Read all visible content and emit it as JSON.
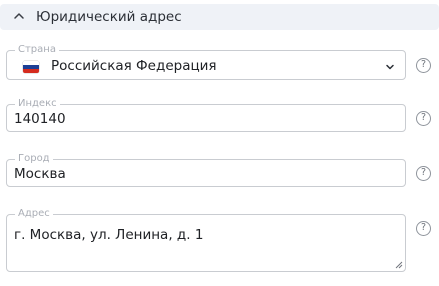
{
  "section": {
    "title": "Юридический адрес",
    "chevron_icon": "chevron-up-icon"
  },
  "fields": {
    "country": {
      "label": "Страна",
      "value": "Российская Федерация",
      "flag_icon": "russia-flag-icon",
      "dropdown_icon": "chevron-down-icon",
      "help": "?"
    },
    "postal_code": {
      "label": "Индекс",
      "value": "140140",
      "help": "?"
    },
    "city": {
      "label": "Город",
      "value": "Москва",
      "help": "?"
    },
    "address": {
      "label": "Адрес",
      "value": "г. Москва, ул. Ленина, д. 1",
      "help": "?"
    }
  },
  "colors": {
    "header_bg": "#eff2f7",
    "border": "#c9ccd1",
    "label": "#a9adb5",
    "text": "#202226"
  }
}
